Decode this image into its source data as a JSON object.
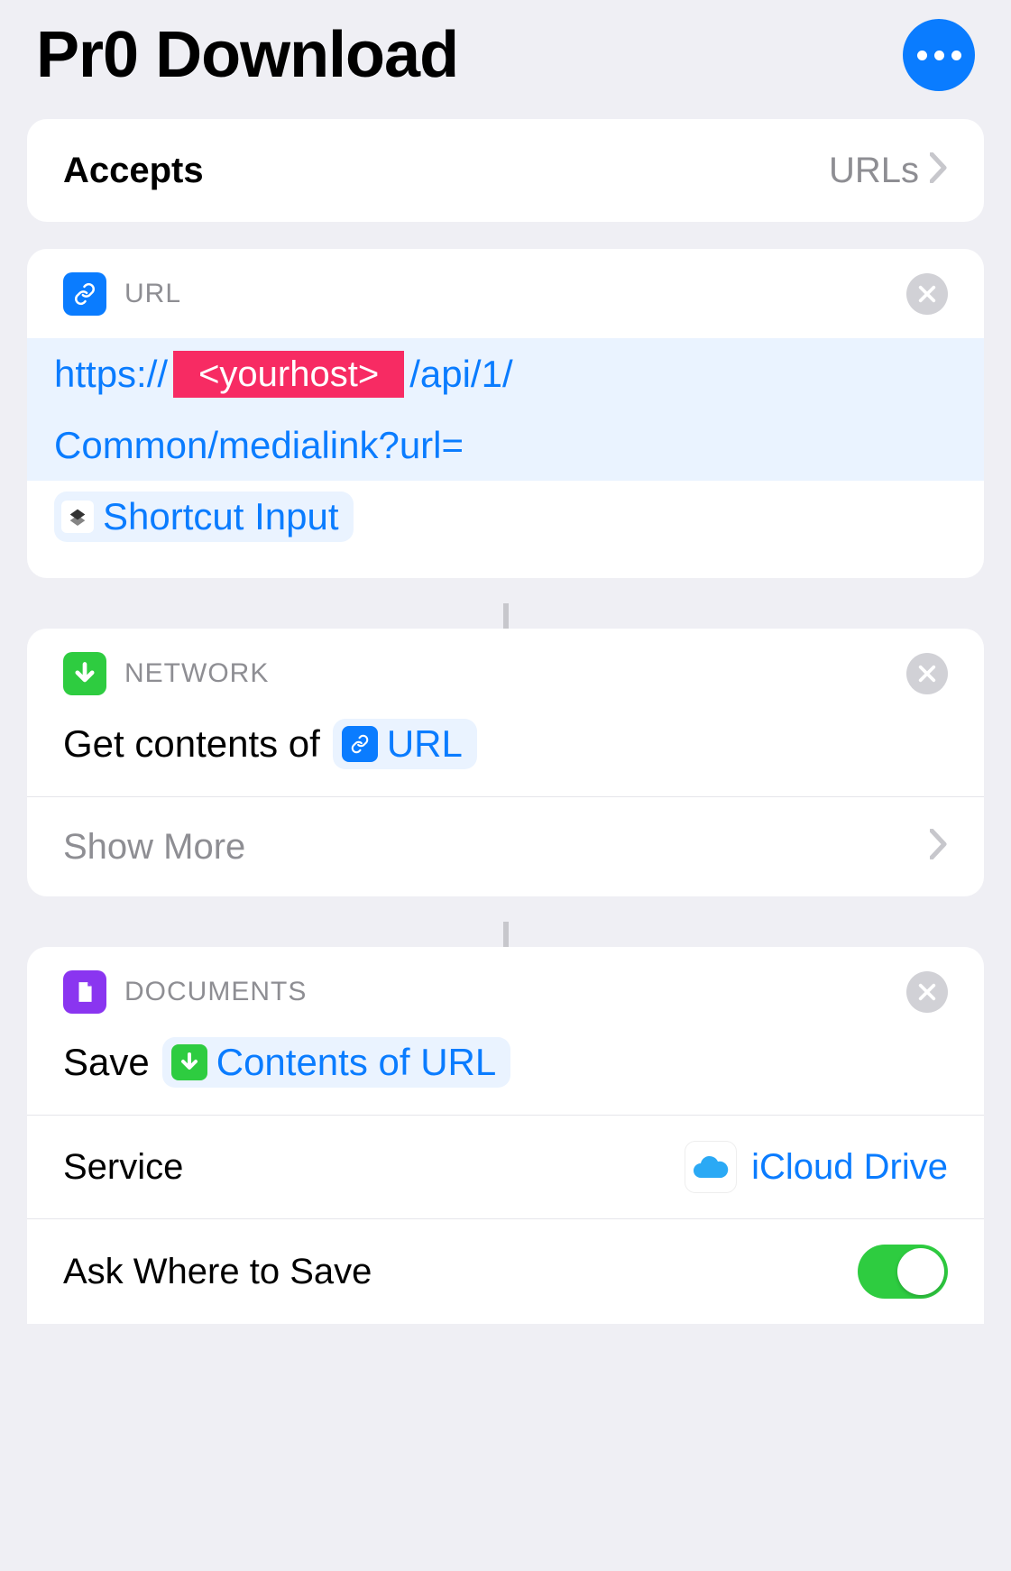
{
  "header": {
    "title": "Pr0 Download"
  },
  "accepts": {
    "label": "Accepts",
    "value": "URLs"
  },
  "urlAction": {
    "category": "URL",
    "url_part1": "https://",
    "redacted": "<yourhost>",
    "url_part2": "/api/1/",
    "url_part3": "Common/medialink?url=",
    "input_var": "Shortcut Input"
  },
  "networkAction": {
    "category": "NETWORK",
    "text": "Get contents of",
    "var": "URL",
    "showMore": "Show More"
  },
  "documentsAction": {
    "category": "DOCUMENTS",
    "text": "Save",
    "var": "Contents of URL",
    "serviceLabel": "Service",
    "serviceValue": "iCloud Drive",
    "askLabel": "Ask Where to Save"
  }
}
